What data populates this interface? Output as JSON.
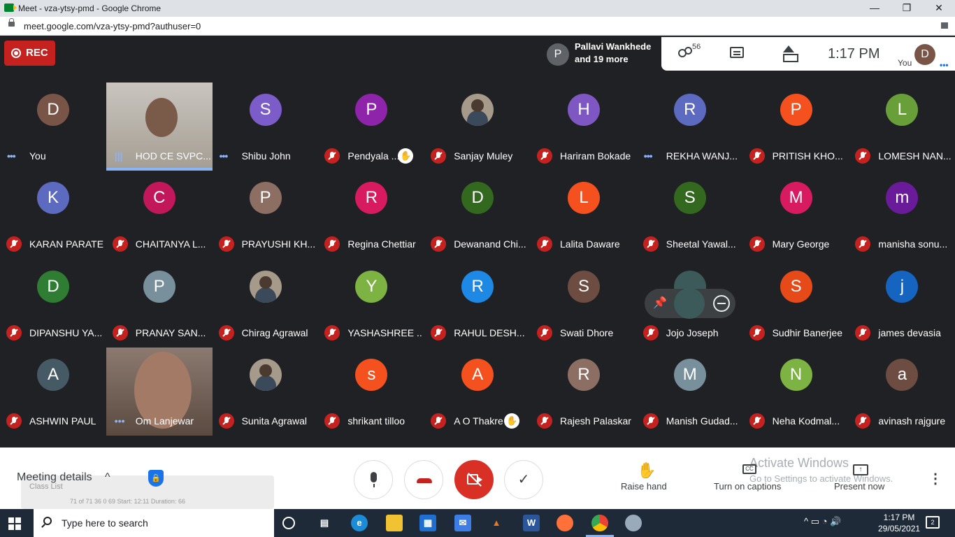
{
  "window": {
    "title": "Meet - vza-ytsy-pmd - Google Chrome",
    "minimize": "—",
    "restore": "❐",
    "close": "✕"
  },
  "address": {
    "url": "meet.google.com/vza-ytsy-pmd?authuser=0"
  },
  "meet": {
    "rec_label": "REC",
    "joiner": {
      "avatar": "P",
      "line1": "Pallavi Wankhede",
      "line2": "and 19 more"
    },
    "people_count": "56",
    "clock": "1:17  PM",
    "you_avatar": "D",
    "you_label": "You",
    "more_dots": "•••"
  },
  "participants": [
    {
      "name": "You",
      "initial": "D",
      "color": "#795548",
      "status": "dots"
    },
    {
      "name": "HOD CE SVPC...",
      "video": true,
      "status": "speaking"
    },
    {
      "name": "Shibu John",
      "initial": "S",
      "color": "#7b5cc9",
      "status": "dots"
    },
    {
      "name": "Pendyala ...",
      "initial": "P",
      "color": "#8e24aa",
      "status": "muted",
      "hand": true
    },
    {
      "name": "Sanjay Muley",
      "photo": true,
      "status": "muted"
    },
    {
      "name": "Hariram Bokade",
      "initial": "H",
      "color": "#7e57c2",
      "status": "muted"
    },
    {
      "name": "REKHA WANJ...",
      "initial": "R",
      "color": "#5c6bc0",
      "status": "dots"
    },
    {
      "name": "PRITISH KHO...",
      "initial": "P",
      "color": "#f4511e",
      "status": "muted"
    },
    {
      "name": "LOMESH NAN...",
      "initial": "L",
      "color": "#689f38",
      "status": "muted"
    },
    {
      "name": "KARAN PARATE",
      "initial": "K",
      "color": "#5c6bc0",
      "status": "muted"
    },
    {
      "name": "CHAITANYA L...",
      "initial": "C",
      "color": "#c2185b",
      "status": "muted"
    },
    {
      "name": "PRAYUSHI KH...",
      "initial": "P",
      "color": "#8d6e63",
      "status": "muted"
    },
    {
      "name": "Regina Chettiar",
      "initial": "R",
      "color": "#d81b60",
      "status": "muted"
    },
    {
      "name": "Dewanand Chi...",
      "initial": "D",
      "color": "#33691e",
      "status": "muted"
    },
    {
      "name": "Lalita Daware",
      "initial": "L",
      "color": "#f4511e",
      "status": "muted"
    },
    {
      "name": "Sheetal Yawal...",
      "initial": "S",
      "color": "#33691e",
      "status": "muted"
    },
    {
      "name": "Mary George",
      "initial": "M",
      "color": "#d81b60",
      "status": "muted"
    },
    {
      "name": "manisha sonu...",
      "initial": "m",
      "color": "#6a1b9a",
      "status": "muted"
    },
    {
      "name": "DIPANSHU YA...",
      "initial": "D",
      "color": "#2e7d32",
      "status": "muted"
    },
    {
      "name": "PRANAY SAN...",
      "initial": "P",
      "color": "#78909c",
      "status": "muted"
    },
    {
      "name": "Chirag Agrawal",
      "photo": true,
      "status": "muted"
    },
    {
      "name": "YASHASHREE ...",
      "initial": "Y",
      "color": "#7cb342",
      "status": "muted"
    },
    {
      "name": "RAHUL DESH...",
      "initial": "R",
      "color": "#1e88e5",
      "status": "muted"
    },
    {
      "name": "Swati Dhore",
      "initial": "S",
      "color": "#6d4c41",
      "status": "muted"
    },
    {
      "name": "Jojo Joseph",
      "initial": "",
      "color": "#3c5a5a",
      "status": "muted",
      "hover": true
    },
    {
      "name": "Sudhir Banerjee",
      "initial": "S",
      "color": "#e64a19",
      "status": "muted"
    },
    {
      "name": "james devasia",
      "initial": "j",
      "color": "#1565c0",
      "status": "muted"
    },
    {
      "name": "ASHWIN PAUL",
      "initial": "A",
      "color": "#455a64",
      "status": "muted"
    },
    {
      "name": "Om Lanjewar",
      "video": true,
      "status": "dots"
    },
    {
      "name": "Sunita Agrawal",
      "photo": true,
      "status": "muted"
    },
    {
      "name": "shrikant tilloo",
      "initial": "s",
      "color": "#f4511e",
      "status": "muted"
    },
    {
      "name": "A O Thakre",
      "initial": "A",
      "color": "#f4511e",
      "status": "muted",
      "hand": true
    },
    {
      "name": "Rajesh Palaskar",
      "initial": "R",
      "color": "#8d6e63",
      "status": "muted"
    },
    {
      "name": "Manish Gudad...",
      "initial": "M",
      "color": "#78909c",
      "status": "muted"
    },
    {
      "name": "Neha Kodmal...",
      "initial": "N",
      "color": "#7cb342",
      "status": "muted"
    },
    {
      "name": "avinash rajgure",
      "initial": "a",
      "color": "#6d4c41",
      "status": "muted"
    }
  ],
  "bottom": {
    "meeting_details": "Meeting details",
    "chevron": "^",
    "class_list": "Class List",
    "class_stats": "71 of 71    36    0    69  Start: 12:11 Duration: 66",
    "raise_hand": "Raise hand",
    "captions": "Turn on captions",
    "present": "Present now",
    "cc": "CC",
    "check": "✓",
    "kebab": "⋮",
    "watermark1": "Activate Windows",
    "watermark2": "Go to Settings to activate Windows."
  },
  "taskbar": {
    "search_placeholder": "Type here to search",
    "time": "1:17 PM",
    "date": "29/05/2021",
    "apps": [
      "cortana",
      "task-view",
      "edge",
      "explorer",
      "store",
      "mail",
      "matlab",
      "word",
      "firefox",
      "chrome",
      "paint"
    ]
  }
}
